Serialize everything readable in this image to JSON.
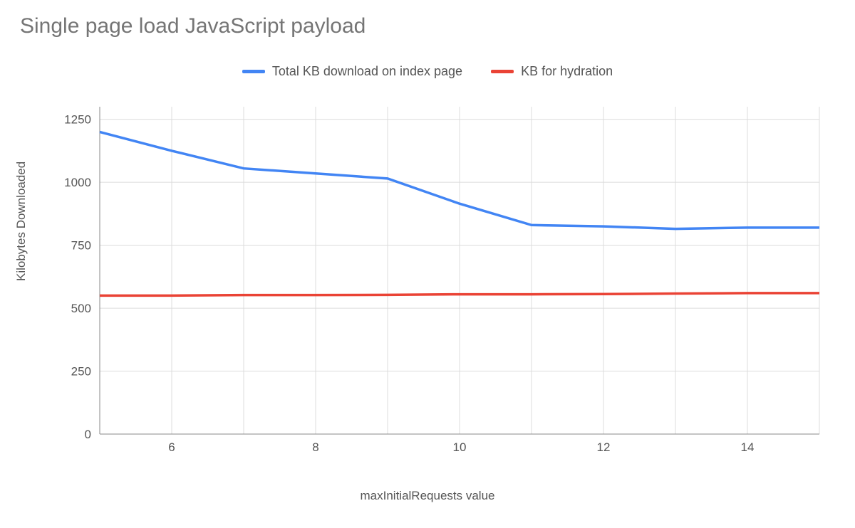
{
  "chart_data": {
    "type": "line",
    "title": "Single page load JavaScript payload",
    "xlabel": "maxInitialRequests value",
    "ylabel": "Kilobytes Downloaded",
    "x": [
      5,
      6,
      7,
      8,
      9,
      10,
      11,
      12,
      13,
      14,
      15
    ],
    "series": [
      {
        "name": "Total KB download on index page",
        "color": "#4285f4",
        "values": [
          1200,
          1125,
          1055,
          1035,
          1015,
          915,
          830,
          825,
          815,
          820,
          820
        ]
      },
      {
        "name": "KB for hydration",
        "color": "#ea4335",
        "values": [
          550,
          550,
          552,
          552,
          553,
          555,
          555,
          556,
          558,
          560,
          560
        ]
      }
    ],
    "x_ticks": [
      6,
      8,
      10,
      12,
      14
    ],
    "y_ticks": [
      0,
      250,
      500,
      750,
      1000,
      1250
    ],
    "xlim": [
      5,
      15
    ],
    "ylim": [
      0,
      1300
    ],
    "legend_position": "top"
  }
}
